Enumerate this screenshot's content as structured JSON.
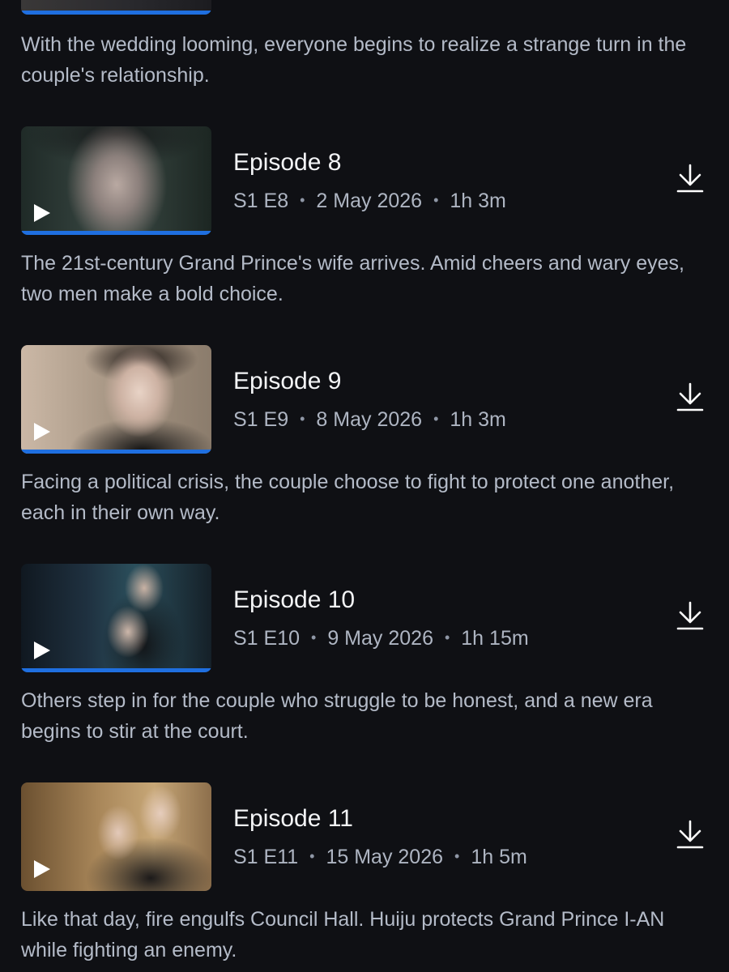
{
  "previous_episode": {
    "progress_fraction": 1.0,
    "description": "With the wedding looming, everyone begins to realize a strange turn in the couple's relationship."
  },
  "episodes": [
    {
      "title": "Episode 8",
      "season_episode": "S1 E8",
      "date": "2 May 2026",
      "duration": "1h 3m",
      "progress_fraction": 1.0,
      "description": "The 21st-century Grand Prince's wife arrives. Amid cheers and wary eyes, two men make a bold choice."
    },
    {
      "title": "Episode 9",
      "season_episode": "S1 E9",
      "date": "8 May 2026",
      "duration": "1h 3m",
      "progress_fraction": 1.0,
      "description": "Facing a political crisis, the couple choose to fight to protect one another, each in their own way."
    },
    {
      "title": "Episode 10",
      "season_episode": "S1 E10",
      "date": "9 May 2026",
      "duration": "1h 15m",
      "progress_fraction": 1.0,
      "description": "Others step in for the couple who struggle to be honest, and a new era begins to stir at the court."
    },
    {
      "title": "Episode 11",
      "season_episode": "S1 E11",
      "date": "15 May 2026",
      "duration": "1h 5m",
      "progress_fraction": 0,
      "description": "Like that day, fire engulfs Council Hall. Huiju protects Grand Prince I-AN while fighting an enemy."
    }
  ],
  "separator": "•",
  "icons": {
    "play": "play-icon",
    "download": "download-icon"
  },
  "colors": {
    "background": "#0f1014",
    "progress_accent": "#1f6fe0",
    "title_text": "#f3f4f6",
    "meta_text": "#aeb5c2",
    "description_text": "#b4bbc8"
  }
}
